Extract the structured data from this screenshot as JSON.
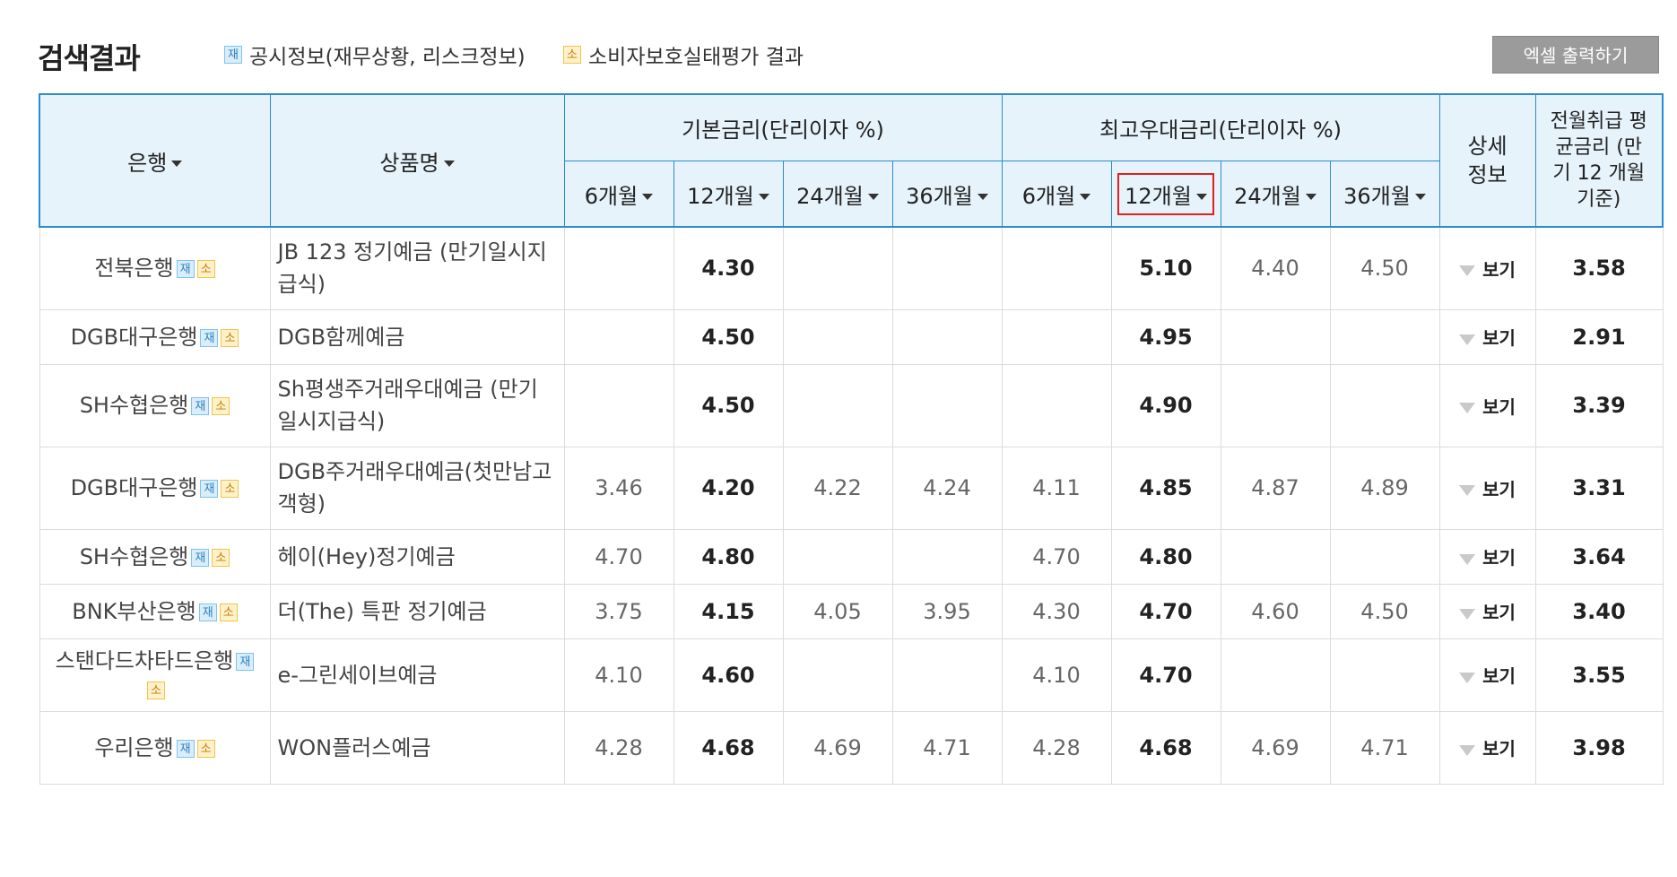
{
  "header": {
    "title": "검색결과",
    "legend": [
      {
        "badge": "재",
        "label": "공시정보(재무상황, 리스크정보)"
      },
      {
        "badge": "소",
        "label": "소비자보호실태평가 결과"
      }
    ],
    "excel_label": "엑셀 출력하기"
  },
  "table": {
    "col_bank": "은행",
    "col_product": "상품명",
    "group_base": "기본금리(단리이자 %)",
    "group_max": "최고우대금리(단리이자 %)",
    "col_detail": "상세정보",
    "col_avg": "전월취급 평균금리 (만기 12 개월 기준)",
    "terms": [
      "6개월",
      "12개월",
      "24개월",
      "36개월"
    ],
    "view_label": "보기",
    "rows": [
      {
        "bank": "전북은행",
        "product": "JB 123 정기예금 (만기일시지급식)",
        "b6": "",
        "b12": "4.30",
        "b24": "",
        "b36": "",
        "m6": "",
        "m12": "5.10",
        "m24": "4.40",
        "m36": "4.50",
        "avg": "3.58"
      },
      {
        "bank": "DGB대구은행",
        "product": "DGB함께예금",
        "b6": "",
        "b12": "4.50",
        "b24": "",
        "b36": "",
        "m6": "",
        "m12": "4.95",
        "m24": "",
        "m36": "",
        "avg": "2.91"
      },
      {
        "bank": "SH수협은행",
        "product": "Sh평생주거래우대예금 (만기일시지급식)",
        "b6": "",
        "b12": "4.50",
        "b24": "",
        "b36": "",
        "m6": "",
        "m12": "4.90",
        "m24": "",
        "m36": "",
        "avg": "3.39"
      },
      {
        "bank": "DGB대구은행",
        "product": "DGB주거래우대예금(첫만남고객형)",
        "b6": "3.46",
        "b12": "4.20",
        "b24": "4.22",
        "b36": "4.24",
        "m6": "4.11",
        "m12": "4.85",
        "m24": "4.87",
        "m36": "4.89",
        "avg": "3.31"
      },
      {
        "bank": "SH수협은행",
        "product": "헤이(Hey)정기예금",
        "b6": "4.70",
        "b12": "4.80",
        "b24": "",
        "b36": "",
        "m6": "4.70",
        "m12": "4.80",
        "m24": "",
        "m36": "",
        "avg": "3.64"
      },
      {
        "bank": "BNK부산은행",
        "product": "더(The) 특판 정기예금",
        "b6": "3.75",
        "b12": "4.15",
        "b24": "4.05",
        "b36": "3.95",
        "m6": "4.30",
        "m12": "4.70",
        "m24": "4.60",
        "m36": "4.50",
        "avg": "3.40"
      },
      {
        "bank": "스탠다드차타드은행",
        "product": "e-그린세이브예금",
        "b6": "4.10",
        "b12": "4.60",
        "b24": "",
        "b36": "",
        "m6": "4.10",
        "m12": "4.70",
        "m24": "",
        "m36": "",
        "avg": "3.55"
      },
      {
        "bank": "우리은행",
        "product": "WON플러스예금",
        "b6": "4.28",
        "b12": "4.68",
        "b24": "4.69",
        "b36": "4.71",
        "m6": "4.28",
        "m12": "4.68",
        "m24": "4.69",
        "m36": "4.71",
        "avg": "3.98"
      }
    ]
  },
  "colors": {
    "header_bg": "#e6f3fb",
    "header_border": "#2b8ccf",
    "sort_highlight": "#e02020",
    "button_bg": "#9b9b9b"
  }
}
